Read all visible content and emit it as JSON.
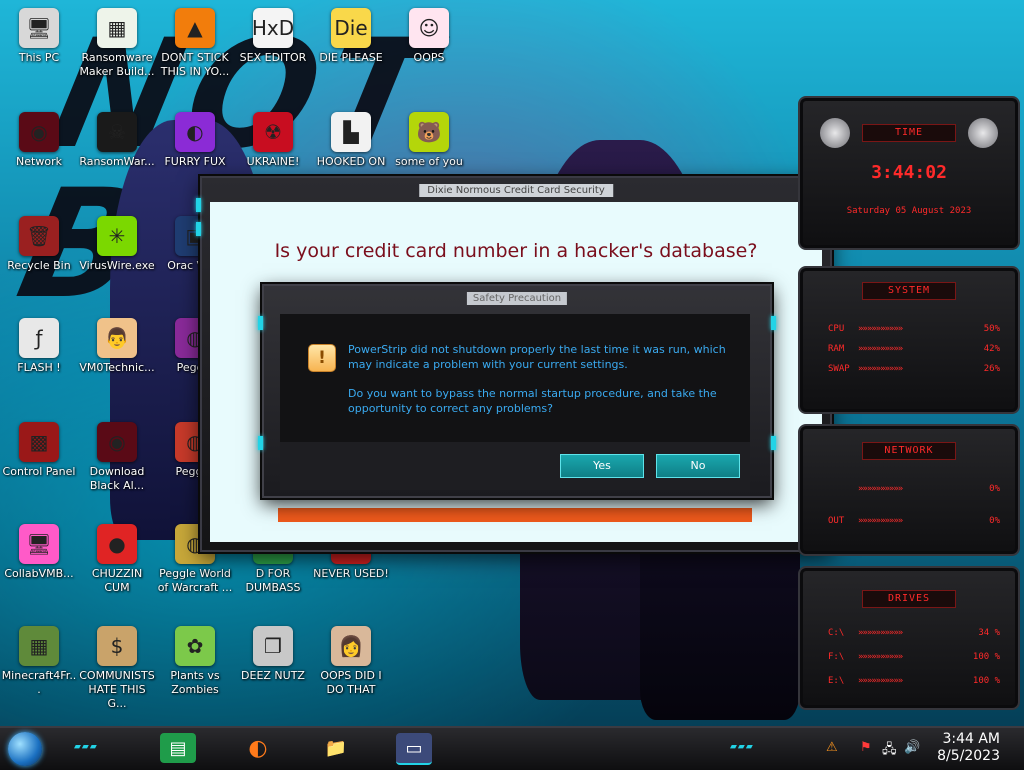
{
  "wallpaper": {
    "text": "NOT BEAST"
  },
  "desktop_icons": [
    {
      "label": "This PC",
      "glyph": "🖥",
      "bg": "#d8d8d8"
    },
    {
      "label": "Ransomware Maker Build...",
      "glyph": "▦",
      "bg": "#eef4ea"
    },
    {
      "label": "DONT STICK THIS IN YO...",
      "glyph": "▲",
      "bg": "#f27d0c"
    },
    {
      "label": "SEX EDITOR",
      "glyph": "HxD",
      "bg": "#f4f4f4"
    },
    {
      "label": "DIE PLEASE",
      "glyph": "Die",
      "bg": "#f9d84a"
    },
    {
      "label": "OOPS",
      "glyph": "☺",
      "bg": "#ffe5f0"
    },
    {
      "label": "Network",
      "glyph": "◉",
      "bg": "#5a0a16"
    },
    {
      "label": "RansomWar...",
      "glyph": "☠",
      "bg": "#1a1a1a"
    },
    {
      "label": "FURRY FUX",
      "glyph": "◐",
      "bg": "#8b2bd6"
    },
    {
      "label": "UKRAINE!",
      "glyph": "☢",
      "bg": "#c80d20"
    },
    {
      "label": "HOOKED ON",
      "glyph": "▙",
      "bg": "#f2f2f2"
    },
    {
      "label": "some of you",
      "glyph": "🐻",
      "bg": "#b4d60a"
    },
    {
      "label": "Recycle Bin",
      "glyph": "🗑",
      "bg": "#9a2020"
    },
    {
      "label": "VirusWire.exe",
      "glyph": "✳",
      "bg": "#7bd800"
    },
    {
      "label": "Orac Virtu",
      "glyph": "▣",
      "bg": "#1f3d72"
    },
    {
      "label": "FLASH !",
      "glyph": "ƒ",
      "bg": "#e8e8e8"
    },
    {
      "label": "VM0Technic...",
      "glyph": "👨",
      "bg": "#f0c28a"
    },
    {
      "label": "Peggle",
      "glyph": "◍",
      "bg": "#8a2a9a"
    },
    {
      "label": "Control Panel",
      "glyph": "▩",
      "bg": "#9a1818"
    },
    {
      "label": "Download Black Al...",
      "glyph": "◉",
      "bg": "#5a0a16"
    },
    {
      "label": "Pegg D",
      "glyph": "◍",
      "bg": "#c83a2a"
    },
    {
      "label": "CollabVMB...",
      "glyph": "🖥",
      "bg": "#ff5ac8"
    },
    {
      "label": "CHUZZIN CUM",
      "glyph": "●",
      "bg": "#e02424"
    },
    {
      "label": "Peggle World of Warcraft ...",
      "glyph": "◍",
      "bg": "#c8a83a"
    },
    {
      "label": "D FOR DUMBASS",
      "glyph": "D",
      "bg": "#2ea44a"
    },
    {
      "label": "NEVER USED!",
      "glyph": "+++",
      "bg": "#d42020"
    },
    {
      "label": "Minecraft4Fr...",
      "glyph": "▦",
      "bg": "#5f8a3a"
    },
    {
      "label": "COMMUNISTS HATE THIS G...",
      "glyph": "$",
      "bg": "#c9a36a"
    },
    {
      "label": "Plants vs Zombies",
      "glyph": "✿",
      "bg": "#7cc94a"
    },
    {
      "label": "DEEZ NUTZ",
      "glyph": "❐",
      "bg": "#c8c8c8"
    },
    {
      "label": "OOPS DID I DO THAT",
      "glyph": "👩",
      "bg": "#d9b89a"
    }
  ],
  "main_dialog": {
    "title": "Dixie Normous Credit Card Security",
    "headline": "Is your credit card number in a hacker's database?"
  },
  "inner_dialog": {
    "title": "Safety Precaution",
    "message_1": "PowerStrip did not shutdown properly the last time it was run, which may indicate a problem with your current settings.",
    "message_2": "Do you want to bypass the normal startup procedure, and take the opportunity to correct any problems?",
    "yes_label": "Yes",
    "no_label": "No"
  },
  "widgets": {
    "time": {
      "title": "TIME",
      "clock": "3:44:02",
      "date": "Saturday 05 August 2023"
    },
    "system": {
      "title": "SYSTEM",
      "rows": [
        {
          "key": "CPU",
          "value": "50%"
        },
        {
          "key": "RAM",
          "value": "42%"
        },
        {
          "key": "SWAP",
          "value": "26%"
        }
      ]
    },
    "network": {
      "title": "NETWORK",
      "rows": [
        {
          "key": "",
          "value": "0%"
        },
        {
          "key": "OUT",
          "value": "0%"
        }
      ]
    },
    "drives": {
      "title": "DRIVES",
      "rows": [
        {
          "key": "C:\\",
          "value": "34 %"
        },
        {
          "key": "F:\\",
          "value": "100 %"
        },
        {
          "key": "E:\\",
          "value": "100 %"
        }
      ]
    }
  },
  "taskbar": {
    "time": "3:44 AM",
    "date": "8/5/2023",
    "apps": [
      {
        "name": "notes-app",
        "glyph": "▤",
        "bg": "#1f9c4a"
      },
      {
        "name": "firefox",
        "glyph": "◐",
        "bg": "transparent"
      },
      {
        "name": "file-explorer",
        "glyph": "📁",
        "bg": "transparent"
      },
      {
        "name": "credit-card-app",
        "glyph": "▭",
        "bg": "#3c4a7a"
      }
    ]
  },
  "colors": {
    "accent_cyan": "#22d3e6",
    "widget_red": "#ff2a2a",
    "headline": "#7a0e1c",
    "message_blue": "#3aaaf0"
  }
}
